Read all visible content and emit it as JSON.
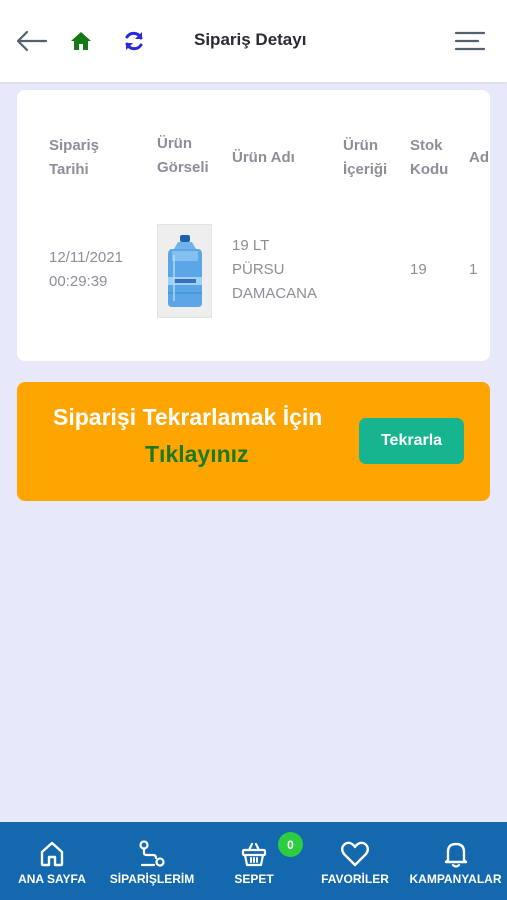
{
  "header": {
    "title": "Sipariş Detayı",
    "icons": [
      "arrow-left-icon",
      "home-icon",
      "refresh-icon",
      "menu-icon"
    ]
  },
  "order_table": {
    "headers": {
      "date": [
        "Sipariş",
        "Tarihi"
      ],
      "image": [
        "Ürün",
        "Görseli"
      ],
      "name": [
        "Ürün Adı"
      ],
      "content": [
        "Ürün",
        "İçeriği"
      ],
      "code": [
        "Stok",
        "Kodu"
      ],
      "qty": [
        "Ad"
      ]
    },
    "rows": [
      {
        "date": [
          "12/11/2021",
          "00:29:39"
        ],
        "name": [
          "19 LT",
          "PÜRSU",
          "DAMACANA"
        ],
        "content": "",
        "code": "19",
        "qty": "1"
      }
    ]
  },
  "repeat_banner": {
    "line1": "Siparişi Tekrarlamak İçin",
    "line2": "Tıklayınız",
    "button_label": "Tekrarla"
  },
  "bottom_nav": {
    "items": [
      {
        "label": "ANA SAYFA",
        "icon": "home-outline-icon"
      },
      {
        "label": "SİPARİŞLERİM",
        "icon": "route-icon"
      },
      {
        "label": "SEPET",
        "icon": "basket-icon"
      },
      {
        "label": "FAVORİLER",
        "icon": "heart-icon"
      },
      {
        "label": "KAMPANYALAR",
        "icon": "bell-icon"
      }
    ],
    "cart_count": "0"
  },
  "colors": {
    "background": "#e8e8fb",
    "banner": "#ffa502",
    "button": "#16b48f",
    "nav": "#1468ad",
    "badge": "#2ecc40",
    "home_icon": "#157a15",
    "refresh_icon": "#2a2ad8"
  }
}
